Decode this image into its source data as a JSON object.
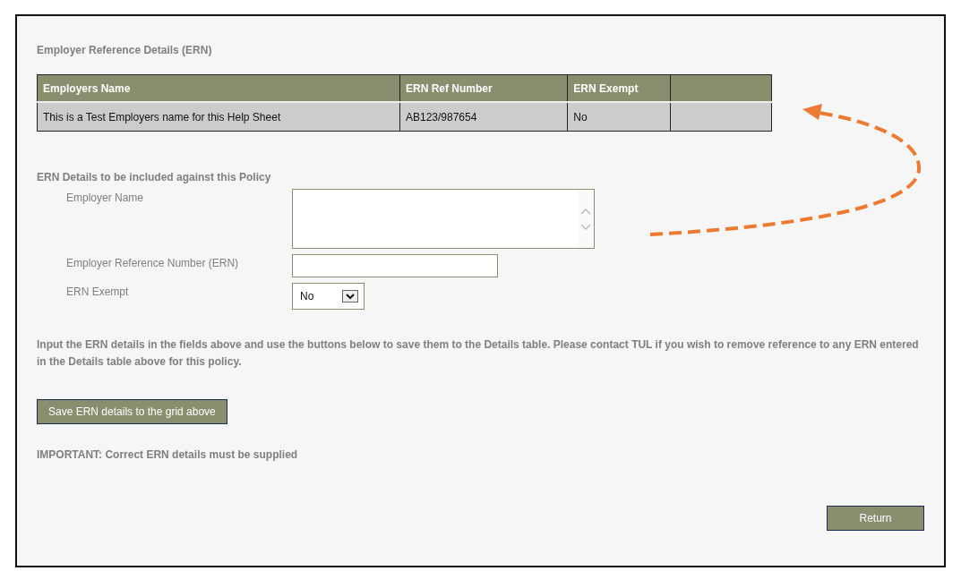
{
  "section_title": "Employer Reference Details (ERN)",
  "table": {
    "columns": [
      "Employers Name",
      "ERN Ref Number",
      "ERN Exempt",
      ""
    ],
    "rows": [
      {
        "cells": [
          "This is a Test Employers name for this Help Sheet",
          "AB123/987654",
          "No",
          ""
        ]
      }
    ]
  },
  "form": {
    "heading": "ERN Details to be included against this Policy",
    "fields": [
      {
        "kind": "textarea",
        "label": "Employer Name"
      },
      {
        "kind": "text",
        "label": "Employer Reference Number (ERN)"
      },
      {
        "kind": "select",
        "label": "ERN Exempt",
        "value": "No"
      }
    ]
  },
  "instructions": "Input the ERN details in the fields above and use the buttons below to save them to the Details table. Please contact TUL if you wish to remove reference to any ERN entered in the Details table above for this policy.",
  "save_button": "Save ERN details to the grid above",
  "notice": "IMPORTANT: Correct ERN details must be supplied",
  "return_button": "Return"
}
